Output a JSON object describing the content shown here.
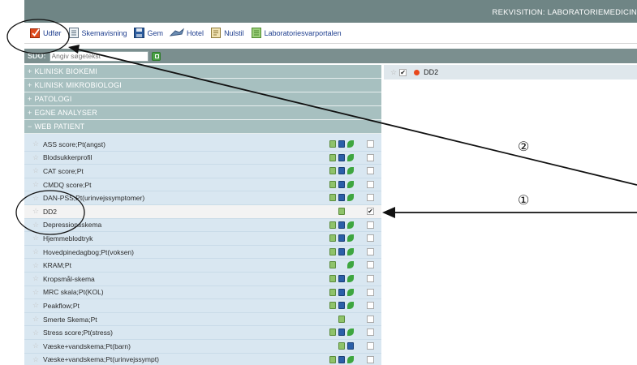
{
  "window": {
    "title": "REKVISITION: LABORATORIEMEDICIN"
  },
  "toolbar": {
    "items": [
      {
        "label": "Udfør",
        "icon": "execute-icon"
      },
      {
        "label": "Skemavisning",
        "icon": "schema-view-icon"
      },
      {
        "label": "Gem",
        "icon": "save-icon"
      },
      {
        "label": "Hotel",
        "icon": "hotel-icon"
      },
      {
        "label": "Nulstil",
        "icon": "reset-icon"
      },
      {
        "label": "Laboratoriesvarportalen",
        "icon": "lab-portal-icon"
      }
    ]
  },
  "search": {
    "label": "SDO:",
    "placeholder": "Angiv søgetekst"
  },
  "categories": [
    {
      "sign": "+",
      "label": "KLINISK BIOKEMI"
    },
    {
      "sign": "+",
      "label": "KLINISK MIKROBIOLOGI"
    },
    {
      "sign": "+",
      "label": "PATOLOGI"
    },
    {
      "sign": "+",
      "label": "EGNE ANALYSER"
    },
    {
      "sign": "−",
      "label": "WEB PATIENT"
    }
  ],
  "items": [
    {
      "label": "ASS score;Pt(angst)",
      "icons": [
        "doc",
        "book",
        "leaf"
      ],
      "checked": false
    },
    {
      "label": "Blodsukkerprofil",
      "icons": [
        "doc",
        "book",
        "leaf"
      ],
      "checked": false
    },
    {
      "label": "CAT score;Pt",
      "icons": [
        "doc",
        "book",
        "leaf"
      ],
      "checked": false
    },
    {
      "label": "CMDQ score;Pt",
      "icons": [
        "doc",
        "book",
        "leaf"
      ],
      "checked": false
    },
    {
      "label": "DAN-PSS;Pt(urinvejssymptomer)",
      "icons": [
        "doc",
        "book",
        "leaf"
      ],
      "checked": false
    },
    {
      "label": "DD2",
      "icons": [
        "empty",
        "doc",
        "empty"
      ],
      "checked": true,
      "selected": true
    },
    {
      "label": "Depressionsskema",
      "icons": [
        "doc",
        "book",
        "leaf"
      ],
      "checked": false
    },
    {
      "label": "Hjemmeblodtryk",
      "icons": [
        "doc",
        "book",
        "leaf"
      ],
      "checked": false
    },
    {
      "label": "Hovedpinedagbog;Pt(voksen)",
      "icons": [
        "doc",
        "book",
        "leaf"
      ],
      "checked": false
    },
    {
      "label": "KRAM;Pt",
      "icons": [
        "doc",
        "empty",
        "leaf"
      ],
      "checked": false
    },
    {
      "label": "Kropsmål-skema",
      "icons": [
        "doc",
        "book",
        "leaf"
      ],
      "checked": false
    },
    {
      "label": "MRC skala;Pt(KOL)",
      "icons": [
        "doc",
        "book",
        "leaf"
      ],
      "checked": false
    },
    {
      "label": "Peakflow;Pt",
      "icons": [
        "doc",
        "book",
        "leaf"
      ],
      "checked": false
    },
    {
      "label": "Smerte Skema;Pt",
      "icons": [
        "empty",
        "doc",
        "empty"
      ],
      "checked": false
    },
    {
      "label": "Stress score;Pt(stress)",
      "icons": [
        "doc",
        "book",
        "leaf"
      ],
      "checked": false
    },
    {
      "label": "Væske+vandskema;Pt(barn)",
      "icons": [
        "empty",
        "doc",
        "book"
      ],
      "checked": false
    },
    {
      "label": "Væske+vandskema;Pt(urinvejssympt)",
      "icons": [
        "doc",
        "book",
        "leaf"
      ],
      "checked": false
    }
  ],
  "selected_panel": {
    "label": "DD2",
    "checked": true,
    "status_color": "#e8481c"
  },
  "annotations": {
    "marker_1": "①",
    "marker_2": "②"
  },
  "colors": {
    "titlebar": "#6f8585",
    "category_bar": "#a7c0c0",
    "list_bg": "#d9e7f1",
    "link": "#1f3f8f"
  }
}
